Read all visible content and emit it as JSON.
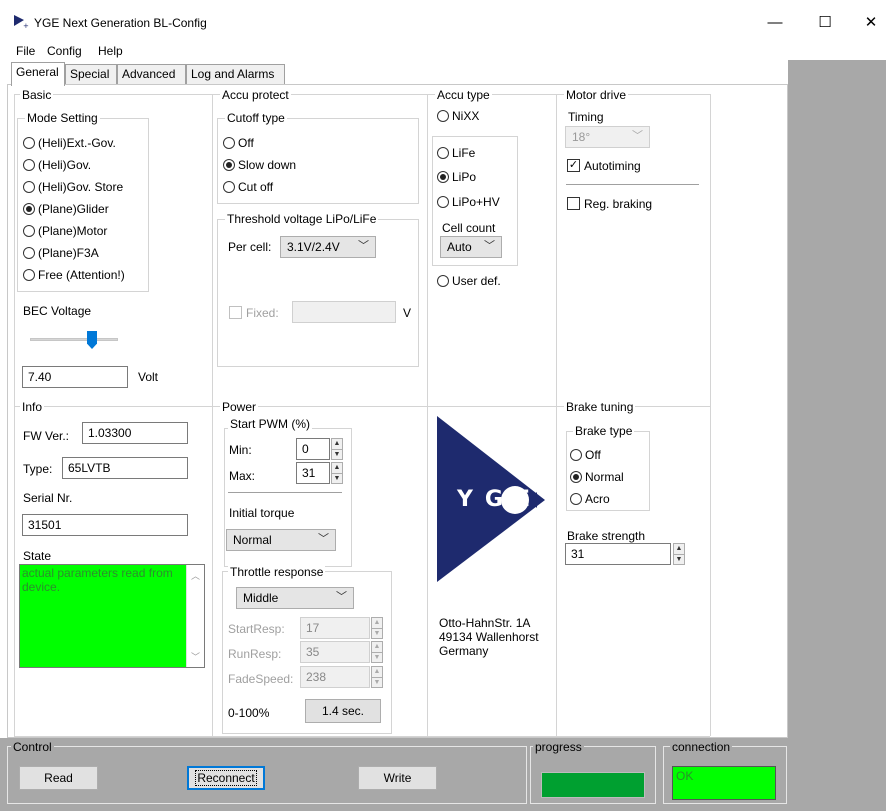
{
  "window": {
    "title": "YGE Next Generation BL-Config",
    "minimize": "—",
    "maximize": "☐",
    "close": "✕"
  },
  "menu": {
    "file": "File",
    "config": "Config",
    "help": "Help"
  },
  "tabs": [
    "General",
    "Special",
    "Advanced",
    "Log and Alarms"
  ],
  "basic": {
    "title": "Basic",
    "mode_setting": {
      "title": "Mode Setting",
      "options": [
        "(Heli)Ext.-Gov.",
        "(Heli)Gov.",
        "(Heli)Gov. Store",
        "(Plane)Glider",
        "(Plane)Motor",
        "(Plane)F3A",
        "Free (Attention!)"
      ],
      "selected_index": 3
    },
    "bec_label": "BEC Voltage",
    "bec_value": "7.40",
    "bec_unit": "Volt",
    "bec_slider_fraction": 0.7
  },
  "accu_protect": {
    "title": "Accu protect",
    "cutoff": {
      "title": "Cutoff type",
      "options": [
        "Off",
        "Slow down",
        "Cut off"
      ],
      "selected_index": 1
    },
    "threshold": {
      "title": "Threshold voltage LiPo/LiFe",
      "per_cell_label": "Per cell:",
      "per_cell_value": "3.1V/2.4V",
      "fixed_label": "Fixed:",
      "fixed_unit": "V"
    }
  },
  "accu_type": {
    "title": "Accu type",
    "nixx": "NiXX",
    "life": "LiFe",
    "lipo": "LiPo",
    "lipo_hv": "LiPo+HV",
    "cell_count_label": "Cell count",
    "cell_count_value": "Auto",
    "user_def": "User def.",
    "selected": "LiPo"
  },
  "motor_drive": {
    "title": "Motor drive",
    "timing_label": "Timing",
    "timing_value": "18°",
    "autotiming_label": "Autotiming",
    "autotiming_checked": true,
    "reg_braking_label": "Reg. braking",
    "reg_braking_checked": false
  },
  "info": {
    "title": "Info",
    "fw_label": "FW Ver.:",
    "fw_value": "1.03300",
    "type_label": "Type:",
    "type_value": "65LVTB",
    "serial_label": "Serial Nr.",
    "serial_value": "31501",
    "state_label": "State",
    "state_text": "actual parameters read from device."
  },
  "power": {
    "title": "Power",
    "start_pwm": {
      "title": "Start PWM (%)",
      "min_label": "Min:",
      "min_value": "0",
      "max_label": "Max:",
      "max_value": "31"
    },
    "initial_torque_label": "Initial torque",
    "initial_torque_value": "Normal",
    "throttle": {
      "title": "Throttle response",
      "mode_value": "Middle",
      "start_resp_label": "StartResp:",
      "start_resp_value": "17",
      "run_resp_label": "RunResp:",
      "run_resp_value": "35",
      "fade_speed_label": "FadeSpeed:",
      "fade_speed_value": "238",
      "range_label": "0-100%",
      "range_value": "1.4 sec."
    }
  },
  "logo": {
    "letters": "YGE",
    "address_line1": "Otto-HahnStr. 1A",
    "address_line2": "49134 Wallenhorst",
    "address_line3": "Germany",
    "color": "#1e2a6e"
  },
  "brake_tuning": {
    "title": "Brake tuning",
    "brake_type_title": "Brake type",
    "options": [
      "Off",
      "Normal",
      "Acro"
    ],
    "selected_index": 1,
    "strength_label": "Brake strength",
    "strength_value": "31"
  },
  "status": {
    "control_title": "Control",
    "read_label": "Read",
    "reconnect_label": "Reconnect",
    "write_label": "Write",
    "progress_title": "progress",
    "progress_fraction": 1.0,
    "connection_title": "connection",
    "connection_value": "OK",
    "indicator_color": "#00ff00",
    "progress_color": "#00a030"
  }
}
